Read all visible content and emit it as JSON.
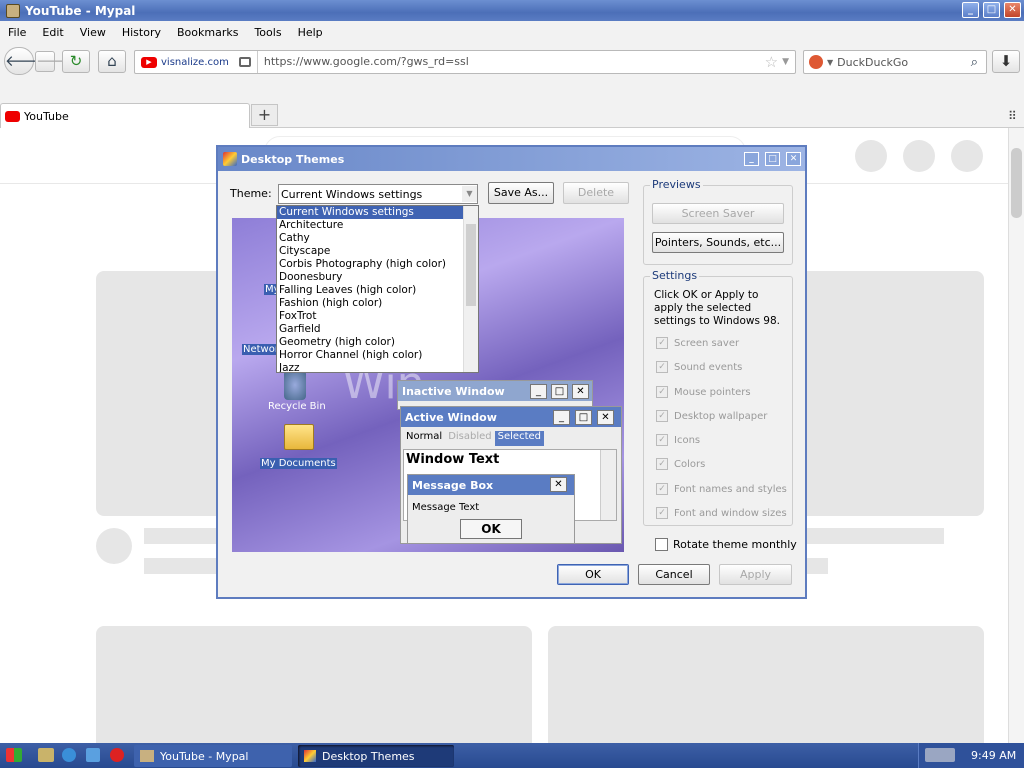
{
  "browser": {
    "title": "YouTube - Mypal",
    "window_controls": [
      "_",
      "□",
      "✕"
    ],
    "menu": [
      "File",
      "Edit",
      "View",
      "History",
      "Bookmarks",
      "Tools",
      "Help"
    ],
    "site_label": "visnalize.com",
    "url": "https://www.google.com/?gws_rd=ssl",
    "search_placeholder": "DuckDuckGo",
    "tab_title": "YouTube",
    "new_tab": "+"
  },
  "dialog": {
    "title": "Desktop Themes",
    "theme_label": "Theme:",
    "theme_value": "Current Windows settings",
    "save_as": "Save As...",
    "delete": "Delete",
    "previews_label": "Previews",
    "screen_saver": "Screen Saver",
    "pointers_sounds": "Pointers, Sounds, etc...",
    "settings_label": "Settings",
    "settings_text": "Click OK or Apply to apply the selected settings to Windows 98.",
    "checkboxes": [
      "Screen saver",
      "Sound events",
      "Mouse pointers",
      "Desktop wallpaper",
      "Icons",
      "Colors",
      "Font names and styles",
      "Font and window sizes"
    ],
    "rotate_label": "Rotate theme monthly",
    "ok": "OK",
    "cancel": "Cancel",
    "apply": "Apply",
    "dropdown_items": [
      "Current Windows settings",
      "Architecture",
      "Cathy",
      "Cityscape",
      "Corbis Photography (high color)",
      "Doonesbury",
      "Falling Leaves (high color)",
      "Fashion (high color)",
      "FoxTrot",
      "Garfield",
      "Geometry (high color)",
      "Horror Channel (high color)",
      "Jazz"
    ]
  },
  "preview": {
    "icons": [
      "My",
      "Networ",
      "Recycle Bin",
      "My Documents"
    ],
    "wordmark": "Win",
    "inactive_window": "Inactive Window",
    "active_window": "Active Window",
    "menu_normal": "Normal",
    "menu_disabled": "Disabled",
    "menu_selected": "Selected",
    "window_text": "Window Text",
    "message_box": "Message Box",
    "message_text": "Message Text",
    "ok": "OK"
  },
  "taskbar": {
    "task1": "YouTube - Mypal",
    "task2": "Desktop Themes",
    "clock": "9:49 AM"
  },
  "colors": {
    "title_blue": "#5a7cc3",
    "accent_blue": "#3f63b3"
  }
}
